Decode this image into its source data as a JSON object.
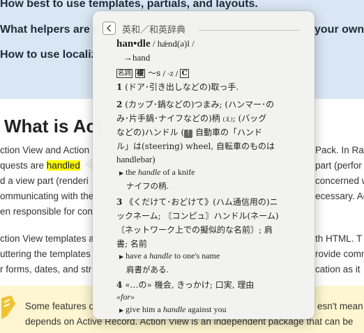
{
  "background": {
    "intro_list": [
      "How best to use templates, partials, and layouts.",
      "What helpers are p",
      "your own",
      "How to use localiz"
    ],
    "heading": "What is Act",
    "lines": [
      {
        "left": "ction View and Action",
        "right": "Pack. In Ra"
      },
      {
        "left_before": "quests are ",
        "highlight": "handled",
        "left_after": " ",
        "right": "part (perfor"
      },
      {
        "left": "d a view part (renderi",
        "right": "concerned w"
      },
      {
        "left": "ommunicating with the",
        "right": "ecessary. Act"
      },
      {
        "left": "en responsible for con",
        "right": ""
      }
    ],
    "lines2": [
      {
        "left": "ction View templates a",
        "right": "th HTML. T"
      },
      {
        "left": "uttering the templates",
        "right": "rovide comm"
      },
      {
        "left": "r forms, dates, and str",
        "right": "cation as it"
      }
    ],
    "note": {
      "line1_left": "Some features o",
      "line1_right": "esn't mean A",
      "line2": "depends on Active Record. Action View is an independent package that can be"
    }
  },
  "popover": {
    "dictionary_name": "英和／和英辞典",
    "headword": "han•dle",
    "pronunciation": " / hǽnd(ə)l / ",
    "arrow_text": "→hand",
    "pos_noun": "名詞",
    "pos_plural": "複",
    "plural_form": "〜s",
    "plural_pron": " / -z / ",
    "pos_countable": "C",
    "senses": [
      {
        "num": "1",
        "text": "(ドア･引き出しなどの)取っ手."
      },
      {
        "num": "2",
        "line1": "(カップ･鍋などの)つまみ; (ハンマー･の",
        "line2": "み･片手鍋･ナイフなどの)柄",
        "line2_mark": "(え)",
        "line2_rest": "; (バッグ",
        "line3_pre": "などの)ハンドル (",
        "line3_symbol": "!",
        "line3_post": "自動車の「ハンド",
        "line4": "ル」は(steering) wheel, 自転車のものは",
        "line5": "handlebar)",
        "example": {
          "pre": "the ",
          "em": "handle",
          "post": " of a knife",
          "translation": "ナイフの柄."
        }
      },
      {
        "num": "3",
        "line1": "《くだけて･おどけて》(ハム通信用の)ニ",
        "line2": "ックネーム; 〘コンピュ〙ハンドル(ネーム)",
        "line3": "〘ネットワーク上での擬似的な名前〙; 肩",
        "line4": "書; 名前",
        "example": {
          "pre": "have a ",
          "em": "handle",
          "post": " to one's name",
          "translation": "肩書がある."
        }
      },
      {
        "num": "4",
        "line1": "«…の» 機会, きっかけ; 口実, 理由",
        "prep": "«for»",
        "example": {
          "pre": "give him a ",
          "em": "handle",
          "post": " against you"
        }
      }
    ]
  }
}
